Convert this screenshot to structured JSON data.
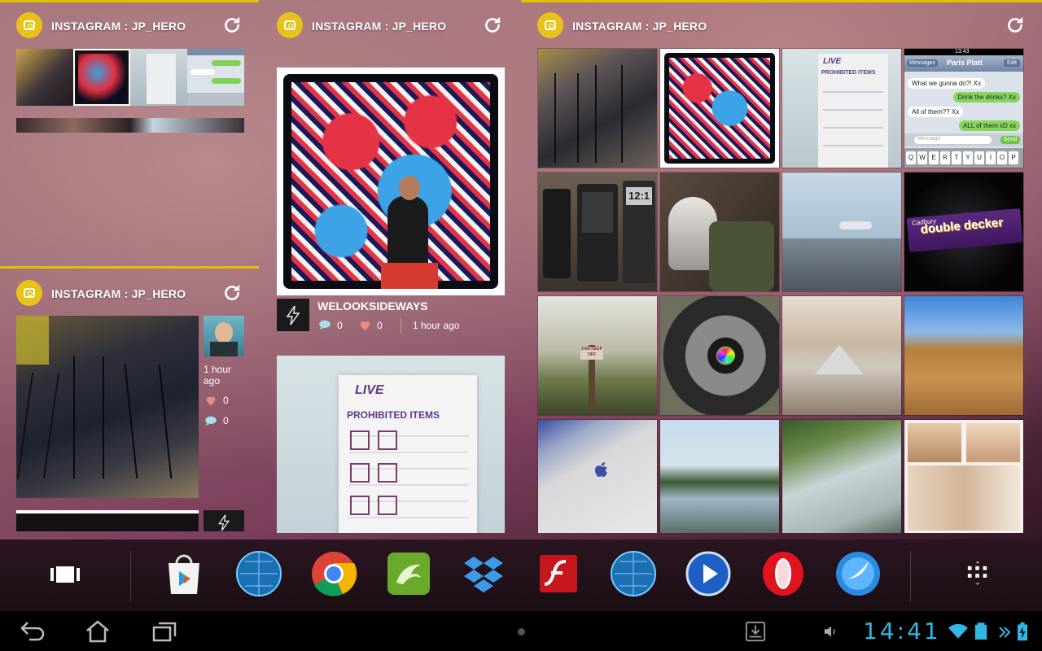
{
  "widgets": {
    "topleft": {
      "title": "INSTAGRAM : JP_HERO"
    },
    "bottomleft": {
      "title": "INSTAGRAM : JP_HERO",
      "time": "1 hour ago",
      "likes": "0",
      "comments": "0"
    },
    "middle": {
      "title": "INSTAGRAM : JP_HERO",
      "post": {
        "username": "WELOOKSIDEWAYS",
        "comments": "0",
        "likes": "0",
        "time": "1 hour ago"
      },
      "sign_event": "LIVE",
      "sign_title": "PROHIBITED ITEMS"
    },
    "right": {
      "title": "INSTAGRAM : JP_HERO",
      "sign_event": "LIVE",
      "sign_title": "PROHIBITED ITEMS",
      "chat": {
        "time": "13:43",
        "contact": "Paris Platt",
        "back": "Messages",
        "edit": "Edit",
        "messages": [
          "What we gunna do?! Xx",
          "Drink the drinks? Xx",
          "All of them?? Xx",
          "ALL of them xD xx"
        ],
        "placeholder": "Message",
        "send": "Send",
        "keys": [
          "Q",
          "W",
          "E",
          "R",
          "T",
          "Y",
          "U",
          "I",
          "O",
          "P"
        ]
      },
      "phone_screen": "12:1",
      "candy_brand": "Cadbury",
      "candy_name": "double decker",
      "post_sign": "DAN KEEP OFF"
    }
  },
  "dock": {
    "apps": [
      "play-store",
      "globe-browser",
      "chrome",
      "dolphin-browser",
      "dropbox",
      "flash-player",
      "globe-browser-2",
      "media-player",
      "opera",
      "web-explorer"
    ]
  },
  "navbar": {
    "clock": "14:41"
  },
  "colors": {
    "accent": "#e3c100",
    "clock": "#33b5e5"
  }
}
